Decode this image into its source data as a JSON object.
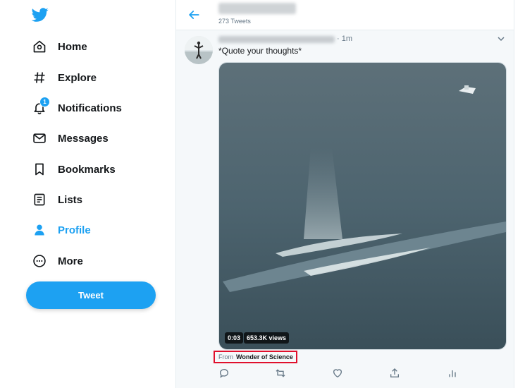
{
  "colors": {
    "accent": "#1da1f2",
    "text": "#14171a",
    "muted": "#657786",
    "highlight": "#e0102c"
  },
  "sidebar": {
    "logo_icon": "twitter-bird-icon",
    "items": [
      {
        "label": "Home",
        "icon": "home-icon"
      },
      {
        "label": "Explore",
        "icon": "hashtag-icon"
      },
      {
        "label": "Notifications",
        "icon": "bell-icon",
        "badge": "1"
      },
      {
        "label": "Messages",
        "icon": "envelope-icon"
      },
      {
        "label": "Bookmarks",
        "icon": "bookmark-icon"
      },
      {
        "label": "Lists",
        "icon": "list-icon"
      },
      {
        "label": "Profile",
        "icon": "user-icon",
        "active": true
      },
      {
        "label": "More",
        "icon": "more-circle-icon"
      }
    ],
    "tweet_button": "Tweet"
  },
  "header": {
    "tweet_count": "273 Tweets"
  },
  "tweet": {
    "time": "· 1m",
    "text": "*Quote your thoughts*",
    "video": {
      "duration": "0:03",
      "views": "653.3K views"
    },
    "from_label": "From",
    "from_source": "Wonder of Science"
  }
}
